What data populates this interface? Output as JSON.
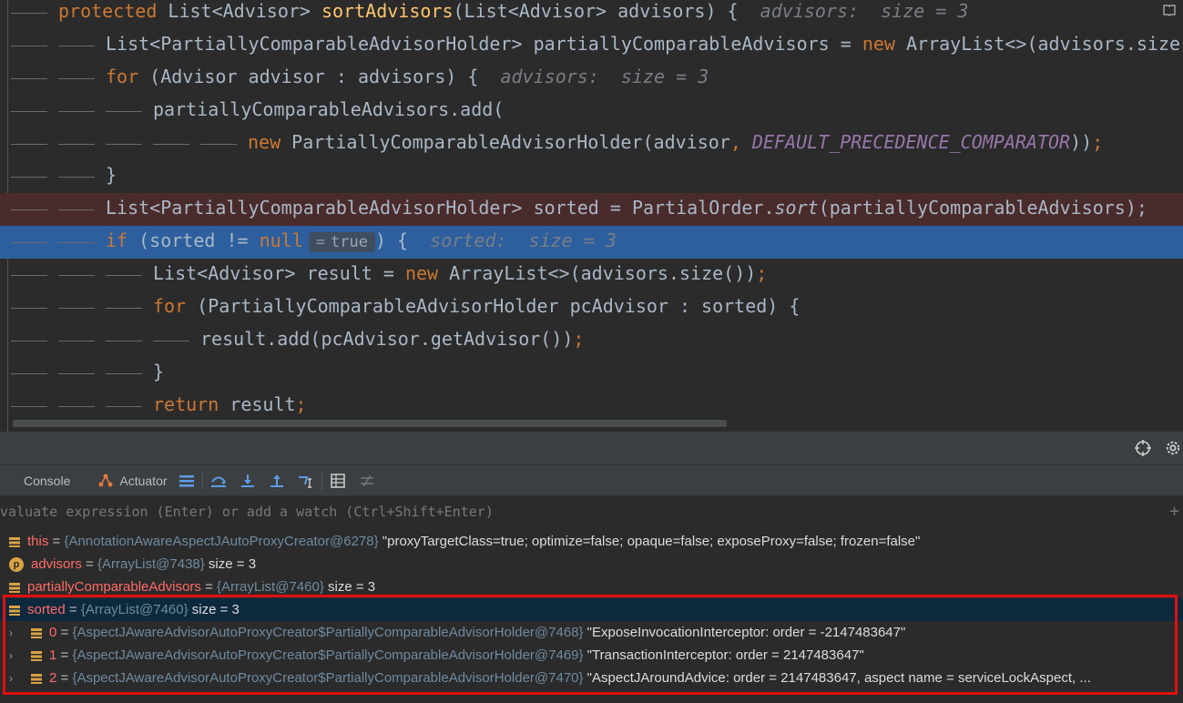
{
  "editor": {
    "lines": [
      {
        "guides": 1,
        "segs": [
          [
            "kw",
            "protected "
          ],
          [
            "t",
            "List<Advisor> "
          ],
          [
            "fn",
            "sortAdvisors"
          ],
          [
            "t",
            "(List<Advisor> advisors) {  "
          ],
          [
            "hint",
            "advisors:  size = 3"
          ]
        ]
      },
      {
        "guides": 2,
        "segs": [
          [
            "t",
            "List<PartiallyComparableAdvisorHolder> partiallyComparableAdvisors = "
          ],
          [
            "kw",
            "new "
          ],
          [
            "t",
            "ArrayList<>(advisors.size());"
          ]
        ]
      },
      {
        "guides": 2,
        "segs": [
          [
            "kw",
            "for "
          ],
          [
            "t",
            "(Advisor advisor : advisors) {  "
          ],
          [
            "hint",
            "advisors:  size = 3"
          ]
        ]
      },
      {
        "guides": 3,
        "segs": [
          [
            "t",
            "partiallyComparableAdvisors.add("
          ]
        ]
      },
      {
        "guides": 5,
        "segs": [
          [
            "kw",
            "new "
          ],
          [
            "t",
            "PartiallyComparableAdvisorHolder(advisor"
          ],
          [
            "kw",
            ", "
          ],
          [
            "cnst",
            "DEFAULT_PRECEDENCE_COMPARATOR"
          ],
          [
            "t",
            "))"
          ],
          [
            "kw",
            ";"
          ]
        ]
      },
      {
        "guides": 2,
        "segs": [
          [
            "t",
            "}"
          ]
        ]
      },
      {
        "guides": 2,
        "err": true,
        "segs": [
          [
            "t",
            "List<PartiallyComparableAdvisorHolder> sorted = PartialOrder."
          ],
          [
            "it",
            "sort"
          ],
          [
            "t",
            "(partiallyComparableAdvisors);"
          ]
        ]
      },
      {
        "guides": 2,
        "cur": true,
        "segs": [
          [
            "kw",
            "if "
          ],
          [
            "t",
            "(sorted != "
          ],
          [
            "kw",
            "null"
          ],
          [
            "inl",
            "true"
          ],
          [
            "t",
            ") {  "
          ],
          [
            "hint",
            "sorted:  size = 3"
          ]
        ]
      },
      {
        "guides": 3,
        "segs": [
          [
            "t",
            "List<Advisor> result = "
          ],
          [
            "kw",
            "new "
          ],
          [
            "t",
            "ArrayList<>(advisors.size())"
          ],
          [
            "kw",
            ";"
          ]
        ]
      },
      {
        "guides": 3,
        "segs": [
          [
            "kw",
            "for "
          ],
          [
            "t",
            "(PartiallyComparableAdvisorHolder pcAdvisor : sorted) {"
          ]
        ]
      },
      {
        "guides": 4,
        "segs": [
          [
            "t",
            "result.add(pcAdvisor.getAdvisor())"
          ],
          [
            "kw",
            ";"
          ]
        ]
      },
      {
        "guides": 3,
        "segs": [
          [
            "t",
            "}"
          ]
        ]
      },
      {
        "guides": 3,
        "segs": [
          [
            "kw",
            "return "
          ],
          [
            "t",
            "result"
          ],
          [
            "kw",
            ";"
          ]
        ]
      }
    ]
  },
  "toolbar": {
    "console_label": "Console",
    "actuator_label": "Actuator"
  },
  "watch": {
    "placeholder": "valuate expression (Enter) or add a watch (Ctrl+Shift+Enter)"
  },
  "variables": [
    {
      "icon": "field",
      "name": "this",
      "eq": " = ",
      "type": "{AnnotationAwareAspectJAutoProxyCreator@6278}",
      "rest": " \"proxyTargetClass=true; optimize=false; opaque=false; exposeProxy=false; frozen=false\"",
      "indent": 0
    },
    {
      "icon": "param",
      "name": "advisors",
      "eq": " = ",
      "type": "{ArrayList@7438}",
      "rest": "  size = 3",
      "indent": 0
    },
    {
      "icon": "field",
      "name": "partiallyComparableAdvisors",
      "eq": " = ",
      "type": "{ArrayList@7460}",
      "rest": "  size = 3",
      "indent": 0
    },
    {
      "icon": "field",
      "name": "sorted",
      "eq": " = ",
      "type": "{ArrayList@7460}",
      "rest": "  size = 3",
      "indent": 0,
      "selected": true
    },
    {
      "icon": "field",
      "name": "0",
      "eq": " = ",
      "type": "{AspectJAwareAdvisorAutoProxyCreator$PartiallyComparableAdvisorHolder@7468}",
      "rest": " \"ExposeInvocationInterceptor: order = -2147483647\"",
      "indent": 1
    },
    {
      "icon": "field",
      "name": "1",
      "eq": " = ",
      "type": "{AspectJAwareAdvisorAutoProxyCreator$PartiallyComparableAdvisorHolder@7469}",
      "rest": " \"TransactionInterceptor: order = 2147483647\"",
      "indent": 1
    },
    {
      "icon": "field",
      "name": "2",
      "eq": " = ",
      "type": "{AspectJAwareAdvisorAutoProxyCreator$PartiallyComparableAdvisorHolder@7470}",
      "rest": " \"AspectJAroundAdvice: order = 2147483647, aspect name = serviceLockAspect, ...",
      "indent": 1
    }
  ]
}
